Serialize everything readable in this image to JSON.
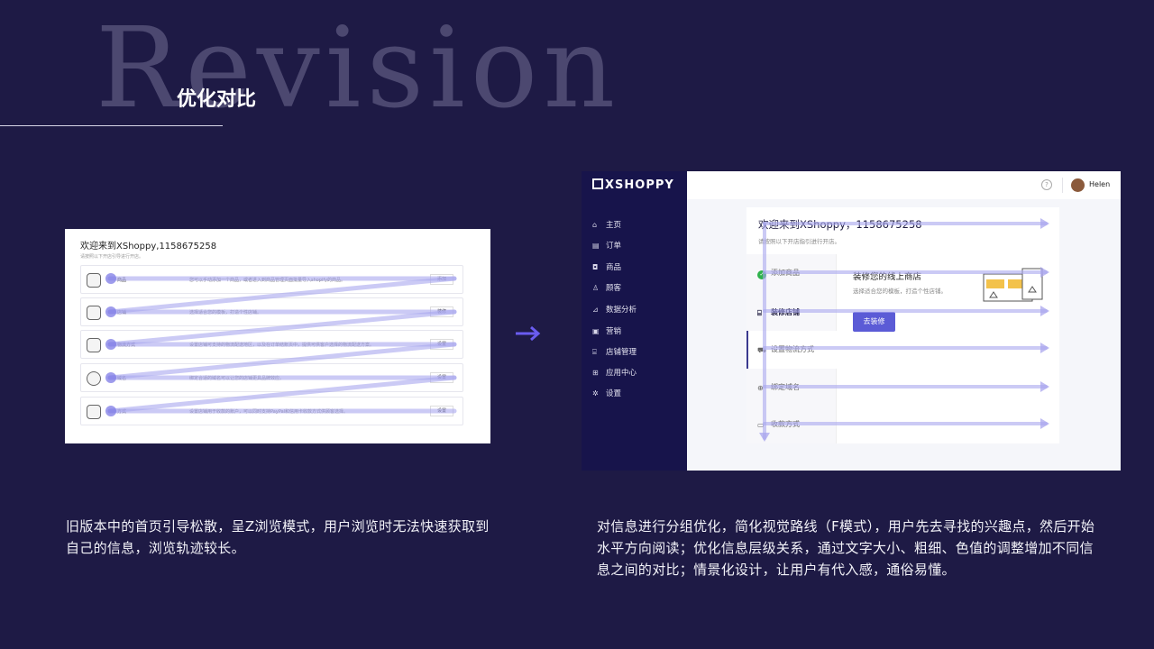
{
  "slide": {
    "bg_word": "Revision",
    "title": "优化对比"
  },
  "old_screen": {
    "welcome": "欢迎来到XShoppy,1158675258",
    "subtitle": "请按照以下开店引导进行开店。",
    "rows": [
      {
        "icon": "bag-icon",
        "name": "商品",
        "desc": "您可以手动添加一个商品，或者进入到商品管理页面批量导入shopify的商品。",
        "button": "添加"
      },
      {
        "icon": "paint-roller-icon",
        "name": "店铺",
        "desc": "选择适合您的模板，打造个性店铺。",
        "button": "装修"
      },
      {
        "icon": "truck-icon",
        "name": "物流方式",
        "desc": "设置店铺可支持的物流配送地区，以及在订单结账页中，提供可供客户选择的物流配送方案。",
        "button": "设置"
      },
      {
        "icon": "globe-icon",
        "name": "域名",
        "desc": "绑定合适的域名可以让您的店铺更具品牌效应。",
        "button": "设置"
      },
      {
        "icon": "money-icon",
        "name": "方式",
        "desc": "设置店铺用于收款的账户，可以同时支持PayPal和信用卡收款方式供顾客选择。",
        "button": "设置"
      }
    ]
  },
  "new_screen": {
    "logo": "XSHOPPY",
    "nav": [
      {
        "icon": "home-icon",
        "glyph": "⌂",
        "label": "主页"
      },
      {
        "icon": "order-icon",
        "glyph": "▤",
        "label": "订单"
      },
      {
        "icon": "goods-icon",
        "glyph": "◘",
        "label": "商品"
      },
      {
        "icon": "customer-icon",
        "glyph": "♙",
        "label": "顾客"
      },
      {
        "icon": "analytics-icon",
        "glyph": "⊿",
        "label": "数据分析"
      },
      {
        "icon": "marketing-icon",
        "glyph": "▣",
        "label": "营销"
      },
      {
        "icon": "store-icon",
        "glyph": "⌸",
        "label": "店铺管理"
      },
      {
        "icon": "apps-icon",
        "glyph": "⊞",
        "label": "应用中心"
      },
      {
        "icon": "settings-icon",
        "glyph": "✲",
        "label": "设置"
      }
    ],
    "help": "?",
    "user": "Helen",
    "welcome": "欢迎来到XShoppy，1158675258",
    "subtitle": "请按照以下开店指引进行开店。",
    "steps": [
      {
        "label": "添加商品",
        "done": true
      },
      {
        "label": "装修店铺",
        "active": true,
        "glyph": "⌸"
      },
      {
        "label": "设置物流方式",
        "glyph": "⛟"
      },
      {
        "label": "绑定域名",
        "glyph": "⊕"
      },
      {
        "label": "收款方式",
        "glyph": "▭"
      }
    ],
    "detail_title": "装修您的线上商店",
    "detail_desc": "选择适合您的模板，打造个性店铺。",
    "detail_button": "去装修"
  },
  "captions": {
    "old": "旧版本中的首页引导松散，呈Z浏览模式，用户浏览时无法快速获取到自己的信息，浏览轨迹较长。",
    "new": "对信息进行分组优化，简化视觉路线（F模式），用户先去寻找的兴趣点，然后开始水平方向阅读；优化信息层级关系，通过文字大小、粗细、色值的调整增加不同信息之间的对比；情景化设计，让用户有代入感，通俗易懂。"
  },
  "colors": {
    "background": "#1e1a45",
    "sidebar": "#17144b",
    "accent": "#5b5bd6",
    "path_highlight": "#a9a6ee"
  }
}
